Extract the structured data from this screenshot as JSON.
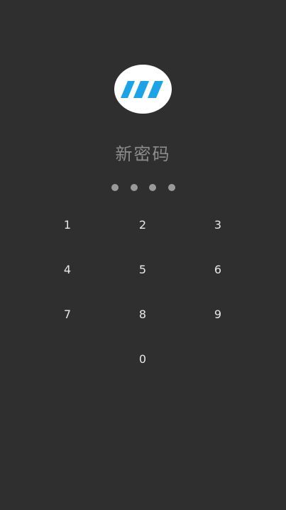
{
  "logo": {
    "icon": "brand-logo-icon",
    "background_color": "#ffffff",
    "accent_color": "#1aa3e8"
  },
  "title": "新密码",
  "pin": {
    "length": 4,
    "entered": 4,
    "dot_color": "#9a9a9a"
  },
  "keypad": {
    "keys": [
      "1",
      "2",
      "3",
      "4",
      "5",
      "6",
      "7",
      "8",
      "9",
      "0"
    ]
  },
  "colors": {
    "background": "#2f2f2f",
    "title_text": "#8c8c8c",
    "key_text": "#e9e9e9"
  }
}
